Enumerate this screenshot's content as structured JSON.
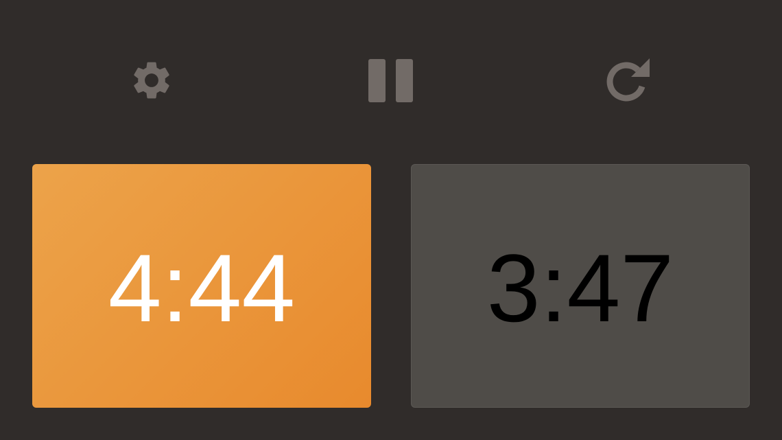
{
  "toolbar": {
    "settings_icon": "gear-icon",
    "pause_icon": "pause-icon",
    "reset_icon": "reset-icon",
    "icon_color": "#726b67"
  },
  "clocks": {
    "player1": {
      "time": "4:44",
      "state": "active",
      "color": "#eca34a",
      "text_color": "#ffffff"
    },
    "player2": {
      "time": "3:47",
      "state": "inactive",
      "color": "#4f4c48",
      "text_color": "#000000"
    }
  }
}
